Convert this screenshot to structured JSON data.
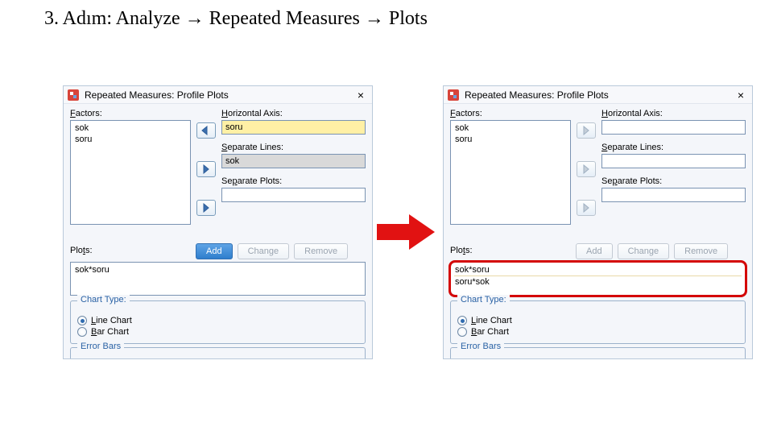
{
  "step_title": "3. Adım: Analyze → Repeated Measures → Plots",
  "dialog_title": "Repeated Measures: Profile Plots",
  "labels": {
    "factors": "Factors:",
    "horizontal_axis": "Horizontal Axis:",
    "separate_lines": "Separate Lines:",
    "separate_plots": "Separate Plots:",
    "plots": "Plots:",
    "chart_type": "Chart Type:",
    "line_chart": "Line Chart",
    "bar_chart": "Bar Chart",
    "error_bars": "Error Bars"
  },
  "buttons": {
    "add": "Add",
    "change": "Change",
    "remove": "Remove"
  },
  "left": {
    "factors": [
      "sok",
      "soru"
    ],
    "horizontal_axis": "soru",
    "separate_lines": "sok",
    "separate_plots": "",
    "plots_list": [
      "sok*soru"
    ],
    "chart_selected": "line"
  },
  "right": {
    "factors": [
      "sok",
      "soru"
    ],
    "horizontal_axis": "",
    "separate_lines": "",
    "separate_plots": "",
    "plots_list": [
      "sok*soru",
      "soru*sok"
    ],
    "chart_selected": "line"
  }
}
